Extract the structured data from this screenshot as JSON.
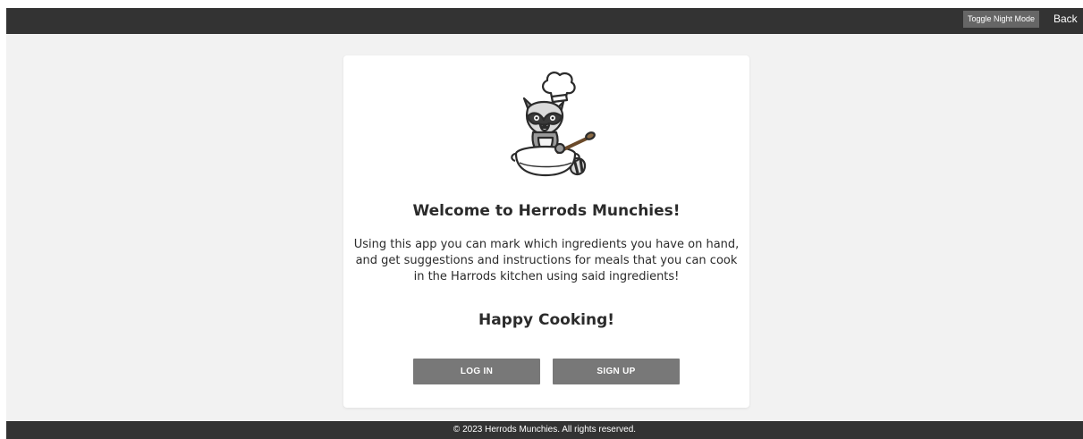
{
  "header": {
    "toggle_label": "Toggle Night Mode",
    "back_label": "Back"
  },
  "card": {
    "mascot_icon": "raccoon-chef-icon",
    "title": "Welcome to Herrods Munchies!",
    "description": "Using this app you can mark which ingredients you have on hand, and get suggestions and instructions for meals that you can cook in the Harrods kitchen using said ingredients!",
    "tagline": "Happy Cooking!",
    "login_label": "LOG IN",
    "signup_label": "SIGN UP"
  },
  "footer": {
    "text": "© 2023 Herrods Munchies. All rights reserved."
  },
  "colors": {
    "bar": "#333333",
    "background": "#f2f2f2",
    "button": "#787878",
    "card": "#ffffff"
  }
}
